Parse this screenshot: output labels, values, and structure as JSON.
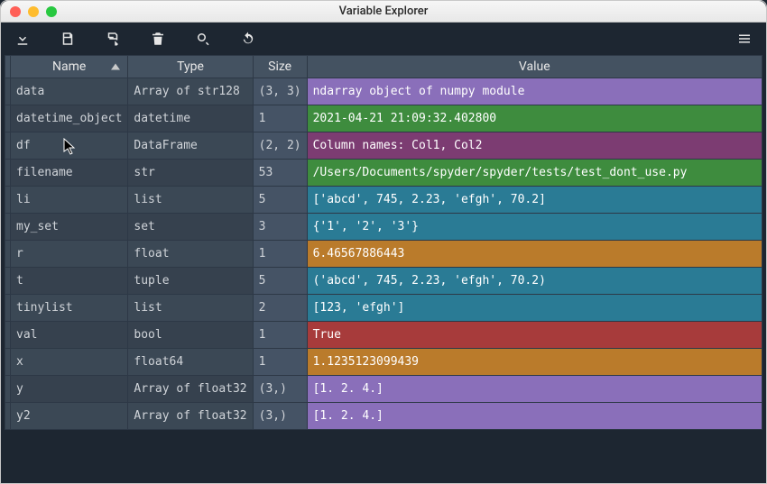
{
  "window": {
    "title": "Variable Explorer"
  },
  "columns": {
    "name": "Name",
    "type": "Type",
    "size": "Size",
    "value": "Value"
  },
  "rows": [
    {
      "name": "data",
      "type": "Array of str128",
      "size": "(3, 3)",
      "value": "ndarray object of numpy module",
      "color": "#8a6fba"
    },
    {
      "name": "datetime_object",
      "type": "datetime",
      "size": "1",
      "value": "2021-04-21 21:09:32.402800",
      "color": "#3e8c3e"
    },
    {
      "name": "df",
      "type": "DataFrame",
      "size": "(2, 2)",
      "value": "Column names: Col1, Col2",
      "color": "#7c3c72"
    },
    {
      "name": "filename",
      "type": "str",
      "size": "53",
      "value": "/Users/Documents/spyder/spyder/tests/test_dont_use.py",
      "color": "#3e8c3e"
    },
    {
      "name": "li",
      "type": "list",
      "size": "5",
      "value": "['abcd', 745, 2.23, 'efgh', 70.2]",
      "color": "#2a7b95"
    },
    {
      "name": "my_set",
      "type": "set",
      "size": "3",
      "value": "{'1', '2', '3'}",
      "color": "#2a7b95"
    },
    {
      "name": "r",
      "type": "float",
      "size": "1",
      "value": "6.46567886443",
      "color": "#ba7b2b"
    },
    {
      "name": "t",
      "type": "tuple",
      "size": "5",
      "value": "('abcd', 745, 2.23, 'efgh', 70.2)",
      "color": "#2a7b95"
    },
    {
      "name": "tinylist",
      "type": "list",
      "size": "2",
      "value": "[123, 'efgh']",
      "color": "#2a7b95"
    },
    {
      "name": "val",
      "type": "bool",
      "size": "1",
      "value": "True",
      "color": "#a73b3b"
    },
    {
      "name": "x",
      "type": "float64",
      "size": "1",
      "value": "1.1235123099439",
      "color": "#ba7b2b"
    },
    {
      "name": "y",
      "type": "Array of float32",
      "size": "(3,)",
      "value": "[1. 2. 4.]",
      "color": "#8a6fba"
    },
    {
      "name": "y2",
      "type": "Array of float32",
      "size": "(3,)",
      "value": "[1. 2. 4.]",
      "color": "#8a6fba"
    }
  ]
}
